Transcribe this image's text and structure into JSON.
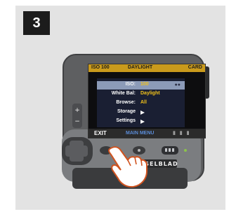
{
  "step": {
    "number": "3"
  },
  "screen": {
    "top_bar": {
      "left": "ISO 100",
      "center": "DAYLIGHT",
      "right": "CARD"
    },
    "menu": {
      "rows": [
        {
          "label": "ISO:",
          "value": "100",
          "selected": true
        },
        {
          "label": "White Bal:",
          "value": "Daylight"
        },
        {
          "label": "Browse:",
          "value": "All"
        },
        {
          "label": "Storage"
        },
        {
          "label": "Settings"
        }
      ]
    },
    "bottom_bar": {
      "exit_label": "EXIT",
      "main_label": "MAIN MENU",
      "right_label": "▮ ▮ ▮"
    }
  },
  "device": {
    "brand_text": "HASSELBLAD"
  }
}
